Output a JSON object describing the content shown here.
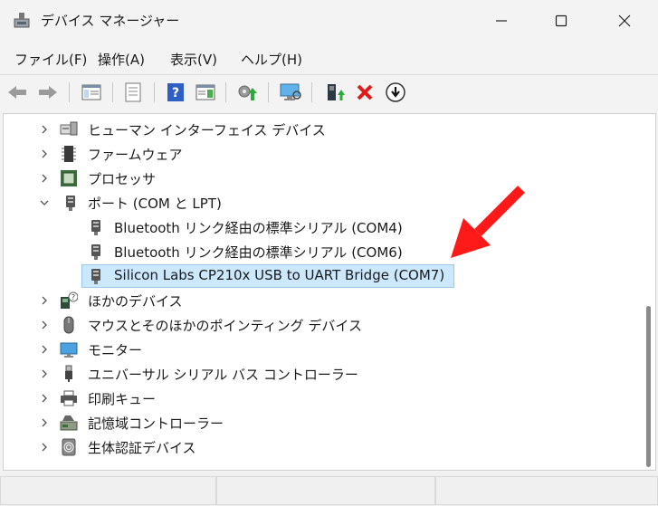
{
  "window": {
    "title": "デバイス マネージャー"
  },
  "menu": [
    "ファイル(F)",
    "操作(A)",
    "表示(V)",
    "ヘルプ(H)"
  ],
  "toolbar": {
    "buttons": [
      "back-icon",
      "forward-icon",
      "properties-icon",
      "list-icon",
      "help-icon",
      "details-icon",
      "update-driver-icon",
      "scan-hardware-icon",
      "enable-device-icon",
      "uninstall-icon",
      "disable-device-icon"
    ]
  },
  "tree": {
    "items": [
      {
        "label": "ヒューマン インターフェイス デバイス",
        "expanded": false,
        "icon": "hid-icon"
      },
      {
        "label": "ファームウェア",
        "expanded": false,
        "icon": "firmware-icon"
      },
      {
        "label": "プロセッサ",
        "expanded": false,
        "icon": "processor-icon"
      },
      {
        "label": "ポート (COM と LPT)",
        "expanded": true,
        "icon": "port-icon"
      },
      {
        "label": "Bluetooth リンク経由の標準シリアル (COM4)",
        "child": true,
        "icon": "port-icon"
      },
      {
        "label": "Bluetooth リンク経由の標準シリアル (COM6)",
        "child": true,
        "icon": "port-icon"
      },
      {
        "label": "Silicon Labs CP210x USB to UART Bridge (COM7)",
        "child": true,
        "selected": true,
        "icon": "port-icon"
      },
      {
        "label": "ほかのデバイス",
        "expanded": false,
        "icon": "unknown-device-icon"
      },
      {
        "label": "マウスとそのほかのポインティング デバイス",
        "expanded": false,
        "icon": "mouse-icon"
      },
      {
        "label": "モニター",
        "expanded": false,
        "icon": "monitor-icon"
      },
      {
        "label": "ユニバーサル シリアル バス コントローラー",
        "expanded": false,
        "icon": "usb-icon"
      },
      {
        "label": "印刷キュー",
        "expanded": false,
        "icon": "printer-icon"
      },
      {
        "label": "記憶域コントローラー",
        "expanded": false,
        "icon": "storage-icon"
      },
      {
        "label": "生体認証デバイス",
        "expanded": false,
        "icon": "biometric-icon"
      }
    ]
  },
  "colors": {
    "selection_bg": "#cce8ff",
    "selection_border": "#99c9ef",
    "annotation_arrow": "#ff1a1a"
  }
}
